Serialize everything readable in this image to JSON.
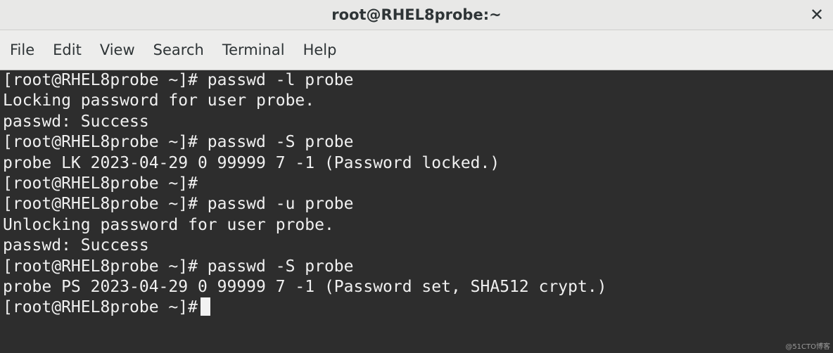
{
  "window": {
    "title": "root@RHEL8probe:~",
    "close_glyph": "✕"
  },
  "menu": {
    "items": [
      "File",
      "Edit",
      "View",
      "Search",
      "Terminal",
      "Help"
    ]
  },
  "terminal": {
    "lines": [
      "[root@RHEL8probe ~]# passwd -l probe",
      "Locking password for user probe.",
      "passwd: Success",
      "[root@RHEL8probe ~]# passwd -S probe",
      "probe LK 2023-04-29 0 99999 7 -1 (Password locked.)",
      "[root@RHEL8probe ~]#",
      "[root@RHEL8probe ~]# passwd -u probe",
      "Unlocking password for user probe.",
      "passwd: Success",
      "[root@RHEL8probe ~]# passwd -S probe",
      "probe PS 2023-04-29 0 99999 7 -1 (Password set, SHA512 crypt.)"
    ],
    "prompt": "[root@RHEL8probe ~]#"
  },
  "watermark": "@51CTO博客",
  "colors": {
    "titlebar_bg": "#e8e8e7",
    "menubar_bg": "#ededec",
    "terminal_bg": "#2d2d2d",
    "terminal_fg": "#f0f0f0"
  }
}
